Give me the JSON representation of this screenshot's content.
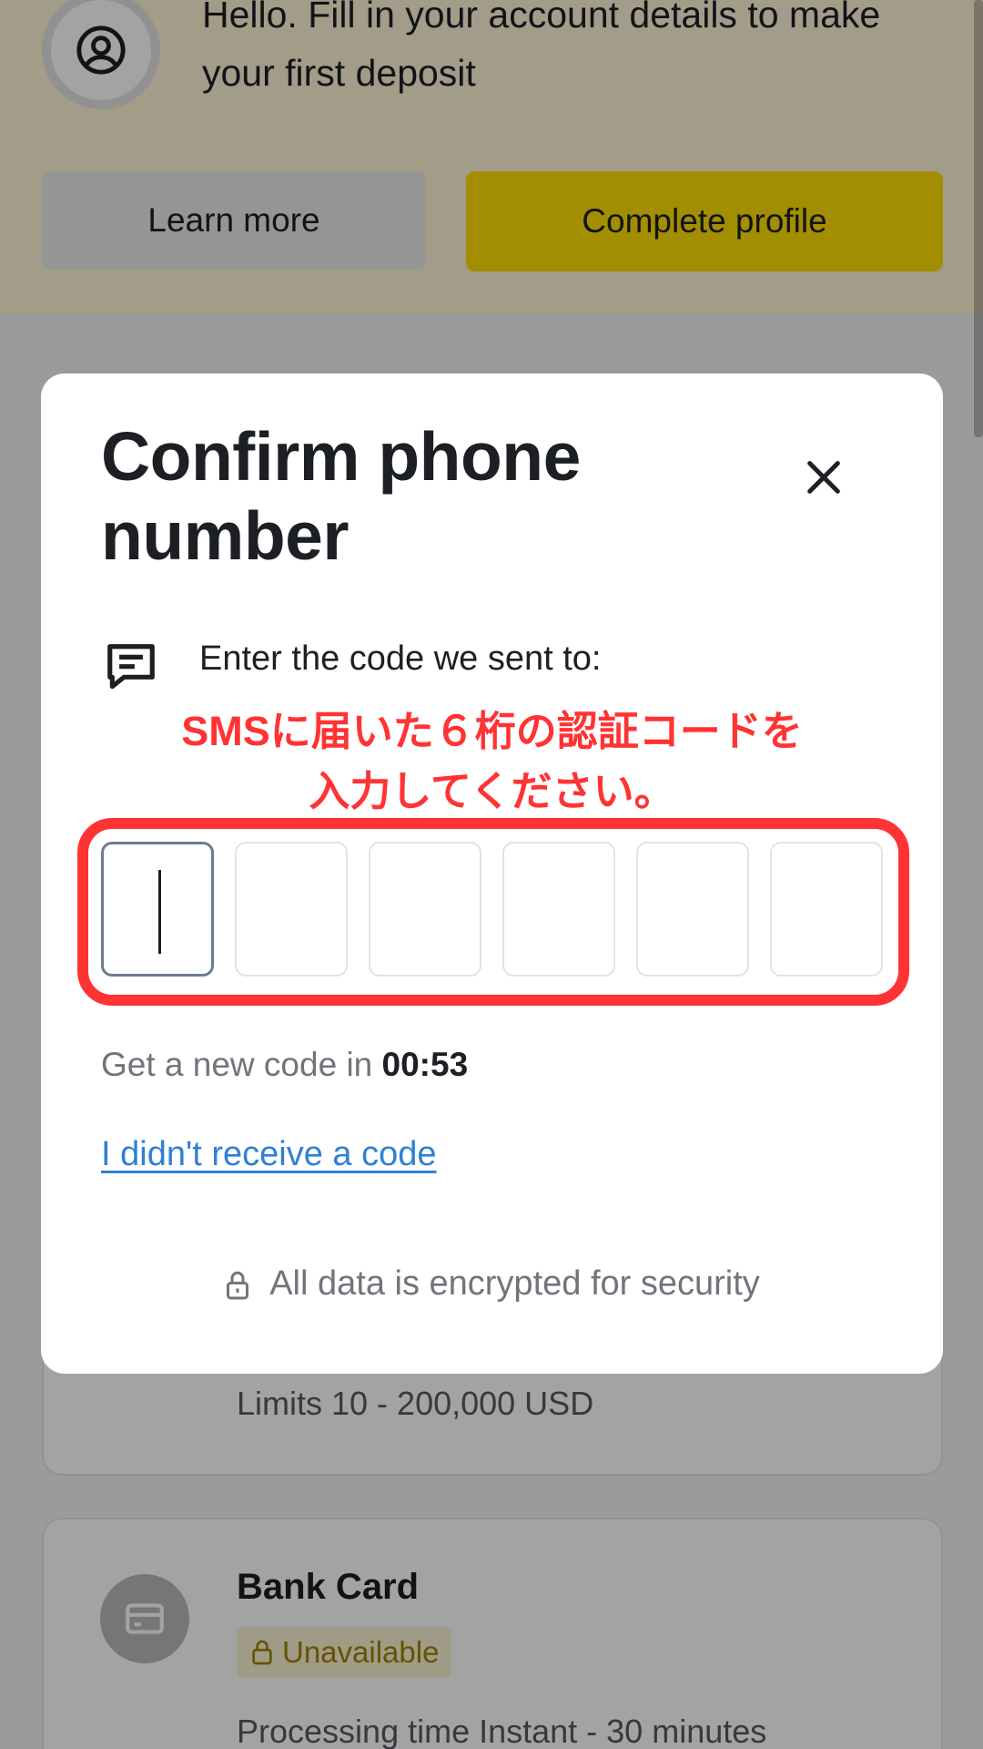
{
  "banner": {
    "text": "Hello. Fill in your account details to make your first deposit",
    "learn_more": "Learn more",
    "complete_profile": "Complete profile"
  },
  "methods": [
    {
      "limits": "Limits 10 - 200,000 USD"
    },
    {
      "name": "Bank Card",
      "status": "Unavailable",
      "processing": "Processing time Instant - 30 minutes"
    }
  ],
  "modal": {
    "title": "Confirm phone number",
    "sent_to_label": "Enter the code we sent to:",
    "annotation_line1": "SMSに届いた６桁の認証コードを",
    "annotation_line2": "入力してください。",
    "code_digits": [
      "",
      "",
      "",
      "",
      "",
      ""
    ],
    "new_code_prefix": "Get a new code in ",
    "timer": "00:53",
    "no_code_link": "I didn't receive a code",
    "security_note": "All data is encrypted for security"
  },
  "colors": {
    "brand_yellow": "#ffde02",
    "annotation_red": "#ff3333",
    "link_blue": "#2f80d6"
  }
}
